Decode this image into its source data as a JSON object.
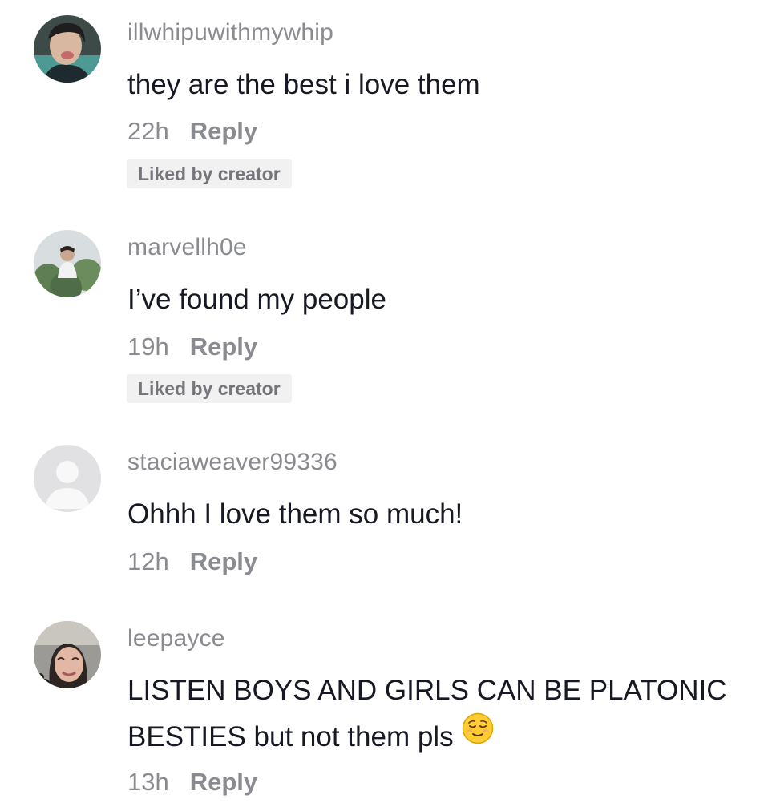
{
  "comments": [
    {
      "username": "illwhipuwithmywhip",
      "text": "they are the best i love them",
      "time": "22h",
      "reply_label": "Reply",
      "badge": "Liked by creator"
    },
    {
      "username": "marvellh0e",
      "text": "I’ve found my people",
      "time": "19h",
      "reply_label": "Reply",
      "badge": "Liked by creator"
    },
    {
      "username": "staciaweaver99336",
      "text": "Ohhh I love them so much!",
      "time": "12h",
      "reply_label": "Reply"
    },
    {
      "username": "leepayce",
      "text_line1": "LISTEN BOYS AND GIRLS CAN BE PLATONIC",
      "text_line2": "BESTIES but not them pls",
      "emoji": "relieved-face",
      "time": "13h",
      "reply_label": "Reply"
    }
  ],
  "colors": {
    "text": "#161823",
    "secondary": "#8a8b91",
    "badge_bg": "#f1f1f2"
  }
}
